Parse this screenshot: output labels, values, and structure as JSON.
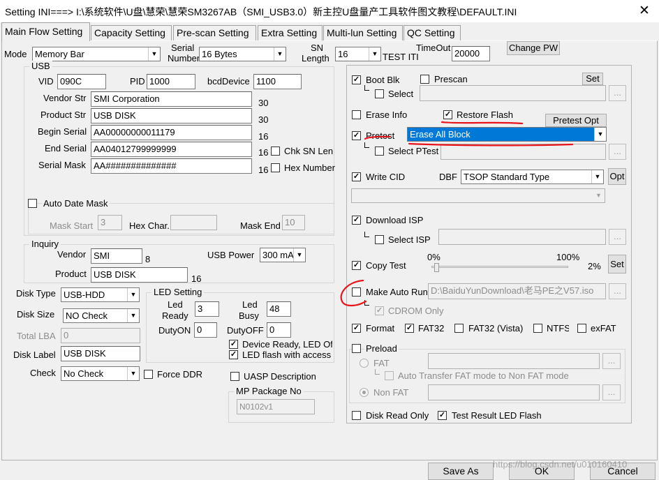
{
  "window": {
    "title": "Setting  INI===> I:\\系统软件\\U盘\\慧荣\\慧荣SM3267AB（SMI_USB3.0）新主控U盘量产工具软件图文教程\\DEFAULT.INI",
    "close_glyph": "✕"
  },
  "tabs": [
    "Main Flow Setting",
    "Capacity Setting",
    "Pre-scan Setting",
    "Extra Setting",
    "Multi-lun Setting",
    "QC Setting"
  ],
  "top": {
    "mode_label": "Mode",
    "mode_value": "Memory Bar",
    "serial_number_label_1": "Serial",
    "serial_number_label_2": "Number",
    "serial_number_value": "16 Bytes",
    "sn_length_label_1": "SN",
    "sn_length_label_2": "Length",
    "sn_length_value": "16",
    "test_item_label": "TEST ITI",
    "timeout_label": "TimeOut",
    "timeout_value": "20000",
    "change_pw_label": "Change PW"
  },
  "usb": {
    "group_title": "USB",
    "vid_label": "VID",
    "vid_value": "090C",
    "pid_label": "PID",
    "pid_value": "1000",
    "bcd_label": "bcdDevice",
    "bcd_value": "1100",
    "vendor_str_label": "Vendor Str",
    "vendor_str_value": "SMI Corporation",
    "vendor_str_len": "30",
    "product_str_label": "Product Str",
    "product_str_value": "USB DISK",
    "product_str_len": "30",
    "begin_serial_label": "Begin Serial",
    "begin_serial_value": "AA00000000011179",
    "begin_serial_len": "16",
    "end_serial_label": "End Serial",
    "end_serial_value": "AA04012799999999",
    "end_serial_len": "16",
    "chk_sn_len_label": "Chk SN Len",
    "serial_mask_label": "Serial Mask",
    "serial_mask_value": "AA##############",
    "serial_mask_len": "16",
    "hex_number_label": "Hex Number",
    "auto_date_mask_label": "Auto Date Mask",
    "mask_start_label": "Mask Start",
    "mask_start_value": "3",
    "hex_char_label": "Hex Char.",
    "hex_char_value": "",
    "mask_end_label": "Mask End",
    "mask_end_value": "10"
  },
  "inquiry": {
    "group_title": "Inquiry",
    "vendor_label": "Vendor",
    "vendor_value": "SMI",
    "vendor_len": "8",
    "usb_power_label": "USB Power",
    "usb_power_value": "300 mA",
    "product_label": "Product",
    "product_value": "USB DISK",
    "product_len": "16"
  },
  "disk": {
    "disk_type_label": "Disk Type",
    "disk_type_value": "USB-HDD",
    "disk_size_label": "Disk Size",
    "disk_size_value": "NO Check",
    "total_lba_label": "Total LBA",
    "total_lba_value": "0",
    "disk_label_label": "Disk Label",
    "disk_label_value": "USB DISK",
    "check_label": "Check",
    "check_value": "No Check",
    "force_ddr_label": "Force DDR"
  },
  "led": {
    "group_title": "LED Setting",
    "led_ready_label_1": "Led",
    "led_ready_label_2": "Ready",
    "led_ready_value": "3",
    "led_busy_label_1": "Led",
    "led_busy_label_2": "Busy",
    "led_busy_value": "48",
    "duty_on_label": "DutyON",
    "duty_on_value": "0",
    "duty_off_label": "DutyOFF",
    "duty_off_value": "0",
    "device_ready_label": "Device Ready, LED Of",
    "led_flash_label": "LED flash with access"
  },
  "uasp": {
    "label": "UASP Description"
  },
  "mp_package": {
    "group_title": "MP Package No",
    "value": "N0102v1"
  },
  "right": {
    "boot_blk_label": "Boot Blk",
    "prescan_label": "Prescan",
    "set_label": "Set",
    "select_label": "Select",
    "browse_label": "...",
    "erase_info_label": "Erase Info",
    "restore_flash_label": "Restore Flash",
    "pretest_opt_label": "Pretest Opt",
    "pretest_label": "Pretest",
    "pretest_value": "Erase All Block",
    "select_ptest_label": "Select PTest",
    "write_cid_label": "Write CID",
    "dbf_label": "DBF",
    "dbf_value": "TSOP Standard Type",
    "opt_label": "Opt",
    "download_isp_label": "Download ISP",
    "select_isp_label": "Select ISP",
    "copy_test_label": "Copy Test",
    "copy_min_label": "0%",
    "copy_max_label": "100%",
    "copy_value_label": "2%",
    "copy_value_fraction": 0.02,
    "copy_set_label": "Set",
    "make_auto_run_label": "Make Auto Run",
    "auto_run_path": "D:\\BaiduYunDownload\\老马PE之V57.iso",
    "cdrom_only_label": "CDROM Only",
    "format_label": "Format",
    "fat32_label": "FAT32",
    "fat32_vista_label": "FAT32 (Vista)",
    "ntfs_label": "NTFS",
    "exfat_label": "exFAT",
    "preload_label": "Preload",
    "fat_label": "FAT",
    "auto_transfer_label": "Auto Transfer FAT mode to Non FAT mode",
    "non_fat_label": "Non FAT",
    "disk_read_only_label": "Disk Read Only",
    "test_result_led_label": "Test Result LED Flash"
  },
  "bottom": {
    "save_as_label": "Save  As",
    "ok_label": "OK",
    "cancel_label": "Cancel",
    "watermark": "https://blog.csdn.net/u010160410"
  },
  "annotations": {
    "color": "#e8141c"
  }
}
